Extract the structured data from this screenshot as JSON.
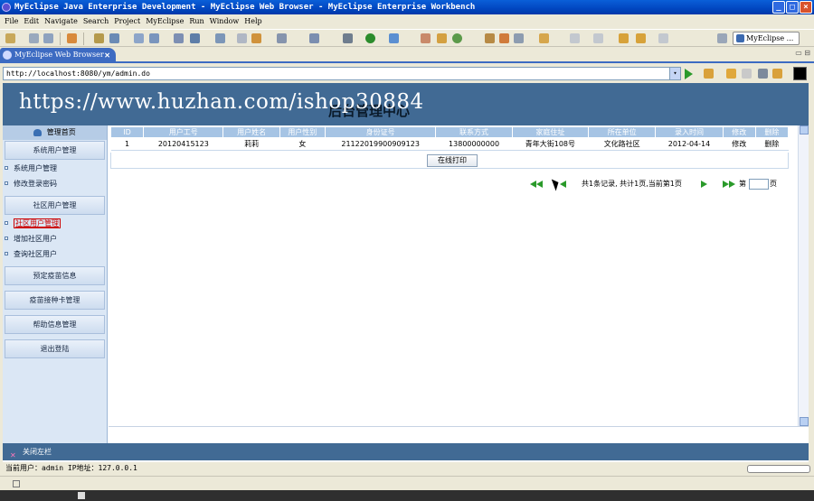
{
  "window": {
    "title": "MyEclipse Java Enterprise Development - MyEclipse Web Browser - MyEclipse Enterprise Workbench",
    "buttons": [
      "_",
      "□",
      "×"
    ]
  },
  "menubar": [
    "File",
    "Edit",
    "Navigate",
    "Search",
    "Project",
    "MyEclipse",
    "Run",
    "Window",
    "Help"
  ],
  "toolbar": {
    "perspective_label": "MyEclipse ..."
  },
  "editor": {
    "tab_label": "MyEclipse Web Browser",
    "tab_close": "✕",
    "view_controls": "▭ ⊟"
  },
  "address": {
    "url": "http://localhost:8080/ym/admin.do",
    "dropdown": "▾"
  },
  "page": {
    "title": "后台管理中心",
    "watermark": "https://www.huzhan.com/ishop30884",
    "sidebar": {
      "home": "管理首页",
      "groups": [
        {
          "header": "系统用户管理",
          "items": [
            "系统用户管理",
            "修改登录密码"
          ]
        },
        {
          "header": "社区用户管理",
          "items": [
            "社区用户管理",
            "增加社区用户",
            "查询社区用户"
          ]
        }
      ],
      "links": [
        "预定疫苗信息",
        "疫苗接种卡管理",
        "帮助信息管理",
        "退出登陆"
      ]
    },
    "table": {
      "headers": [
        "ID",
        "用户工号",
        "用户姓名",
        "用户性别",
        "身份证号",
        "联系方式",
        "家庭住址",
        "所在单位",
        "录入时间",
        "修改",
        "删除"
      ],
      "rows": [
        [
          "1",
          "20120415123",
          "莉莉",
          "女",
          "211220199009091​23",
          "13800000000",
          "青年大街108号",
          "文化路社区",
          "2012-04-14",
          "修改",
          "删除"
        ]
      ],
      "print_button": "在线打印"
    },
    "pager": {
      "summary": "共1条记录, 共计1页,当前第1页",
      "goto_prefix": "第",
      "goto_suffix": "页"
    },
    "footer": {
      "close_sidebar": "关闭左栏",
      "close_icon": "✕"
    }
  },
  "status": {
    "text": "当前用户：admin  IP地址：127.0.0.1"
  }
}
